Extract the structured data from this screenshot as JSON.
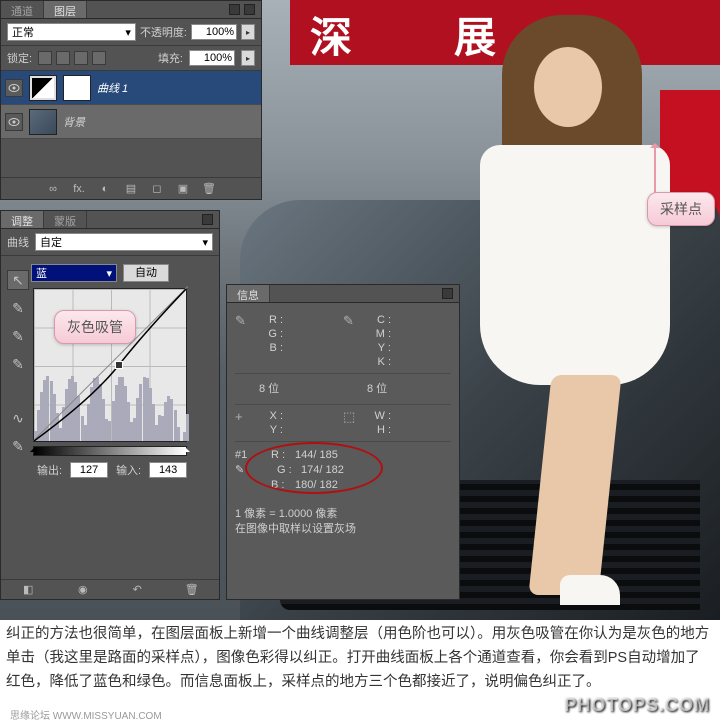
{
  "banner_text": "深　　展",
  "layers_panel": {
    "tabs": [
      "通道",
      "图层"
    ],
    "active_tab": 1,
    "blend_mode": "正常",
    "opacity_label": "不透明度:",
    "opacity_value": "100%",
    "lock_label": "锁定:",
    "fill_label": "填充:",
    "fill_value": "100%",
    "layers": [
      {
        "name": "曲线 1",
        "type": "curves",
        "selected": true
      },
      {
        "name": "背景",
        "type": "bg",
        "selected": false
      }
    ],
    "footer_icons": [
      "∞",
      "fx.",
      "◐",
      "▤",
      "◻",
      "▣",
      "🗑"
    ]
  },
  "adj_panel": {
    "tabs": [
      "调整",
      "蒙版"
    ],
    "active_tab": 0,
    "type_label": "曲线",
    "preset": "自定",
    "channel": "蓝",
    "auto_label": "自动",
    "output_label": "输出:",
    "output_value": "127",
    "input_label": "输入:",
    "input_value": "143",
    "curve_point": {
      "x": 0.56,
      "y": 0.5
    }
  },
  "info_panel": {
    "tab": "信息",
    "rgb": {
      "R": "",
      "G": "",
      "B": ""
    },
    "cmyk": {
      "C": "",
      "M": "",
      "Y": "",
      "K": ""
    },
    "bits_label": "8 位",
    "xy": {
      "X": "",
      "Y": ""
    },
    "wh": {
      "W": "",
      "H": ""
    },
    "sample": {
      "label": "#1",
      "R": "144/ 185",
      "G": "174/ 182",
      "B": "180/ 182"
    },
    "note_line1": "1 像素 = 1.0000 像素",
    "note_line2": "在图像中取样以设置灰场"
  },
  "callouts": {
    "gray_eyedropper": "灰色吸管",
    "sample_point": "采样点"
  },
  "article": "纠正的方法也很简单，在图层面板上新增一个曲线调整层（用色阶也可以）。用灰色吸管在你认为是灰色的地方单击（我这里是路面的采样点），图像色彩得以纠正。打开曲线面板上各个通道查看，你会看到PS自动增加了红色，降低了蓝色和绿色。而信息面板上，采样点的地方三个色都接近了，说明偏色纠正了。",
  "watermark": "PHOTOPS.COM",
  "watermark_small": "思缘论坛  WWW.MISSYUAN.COM"
}
